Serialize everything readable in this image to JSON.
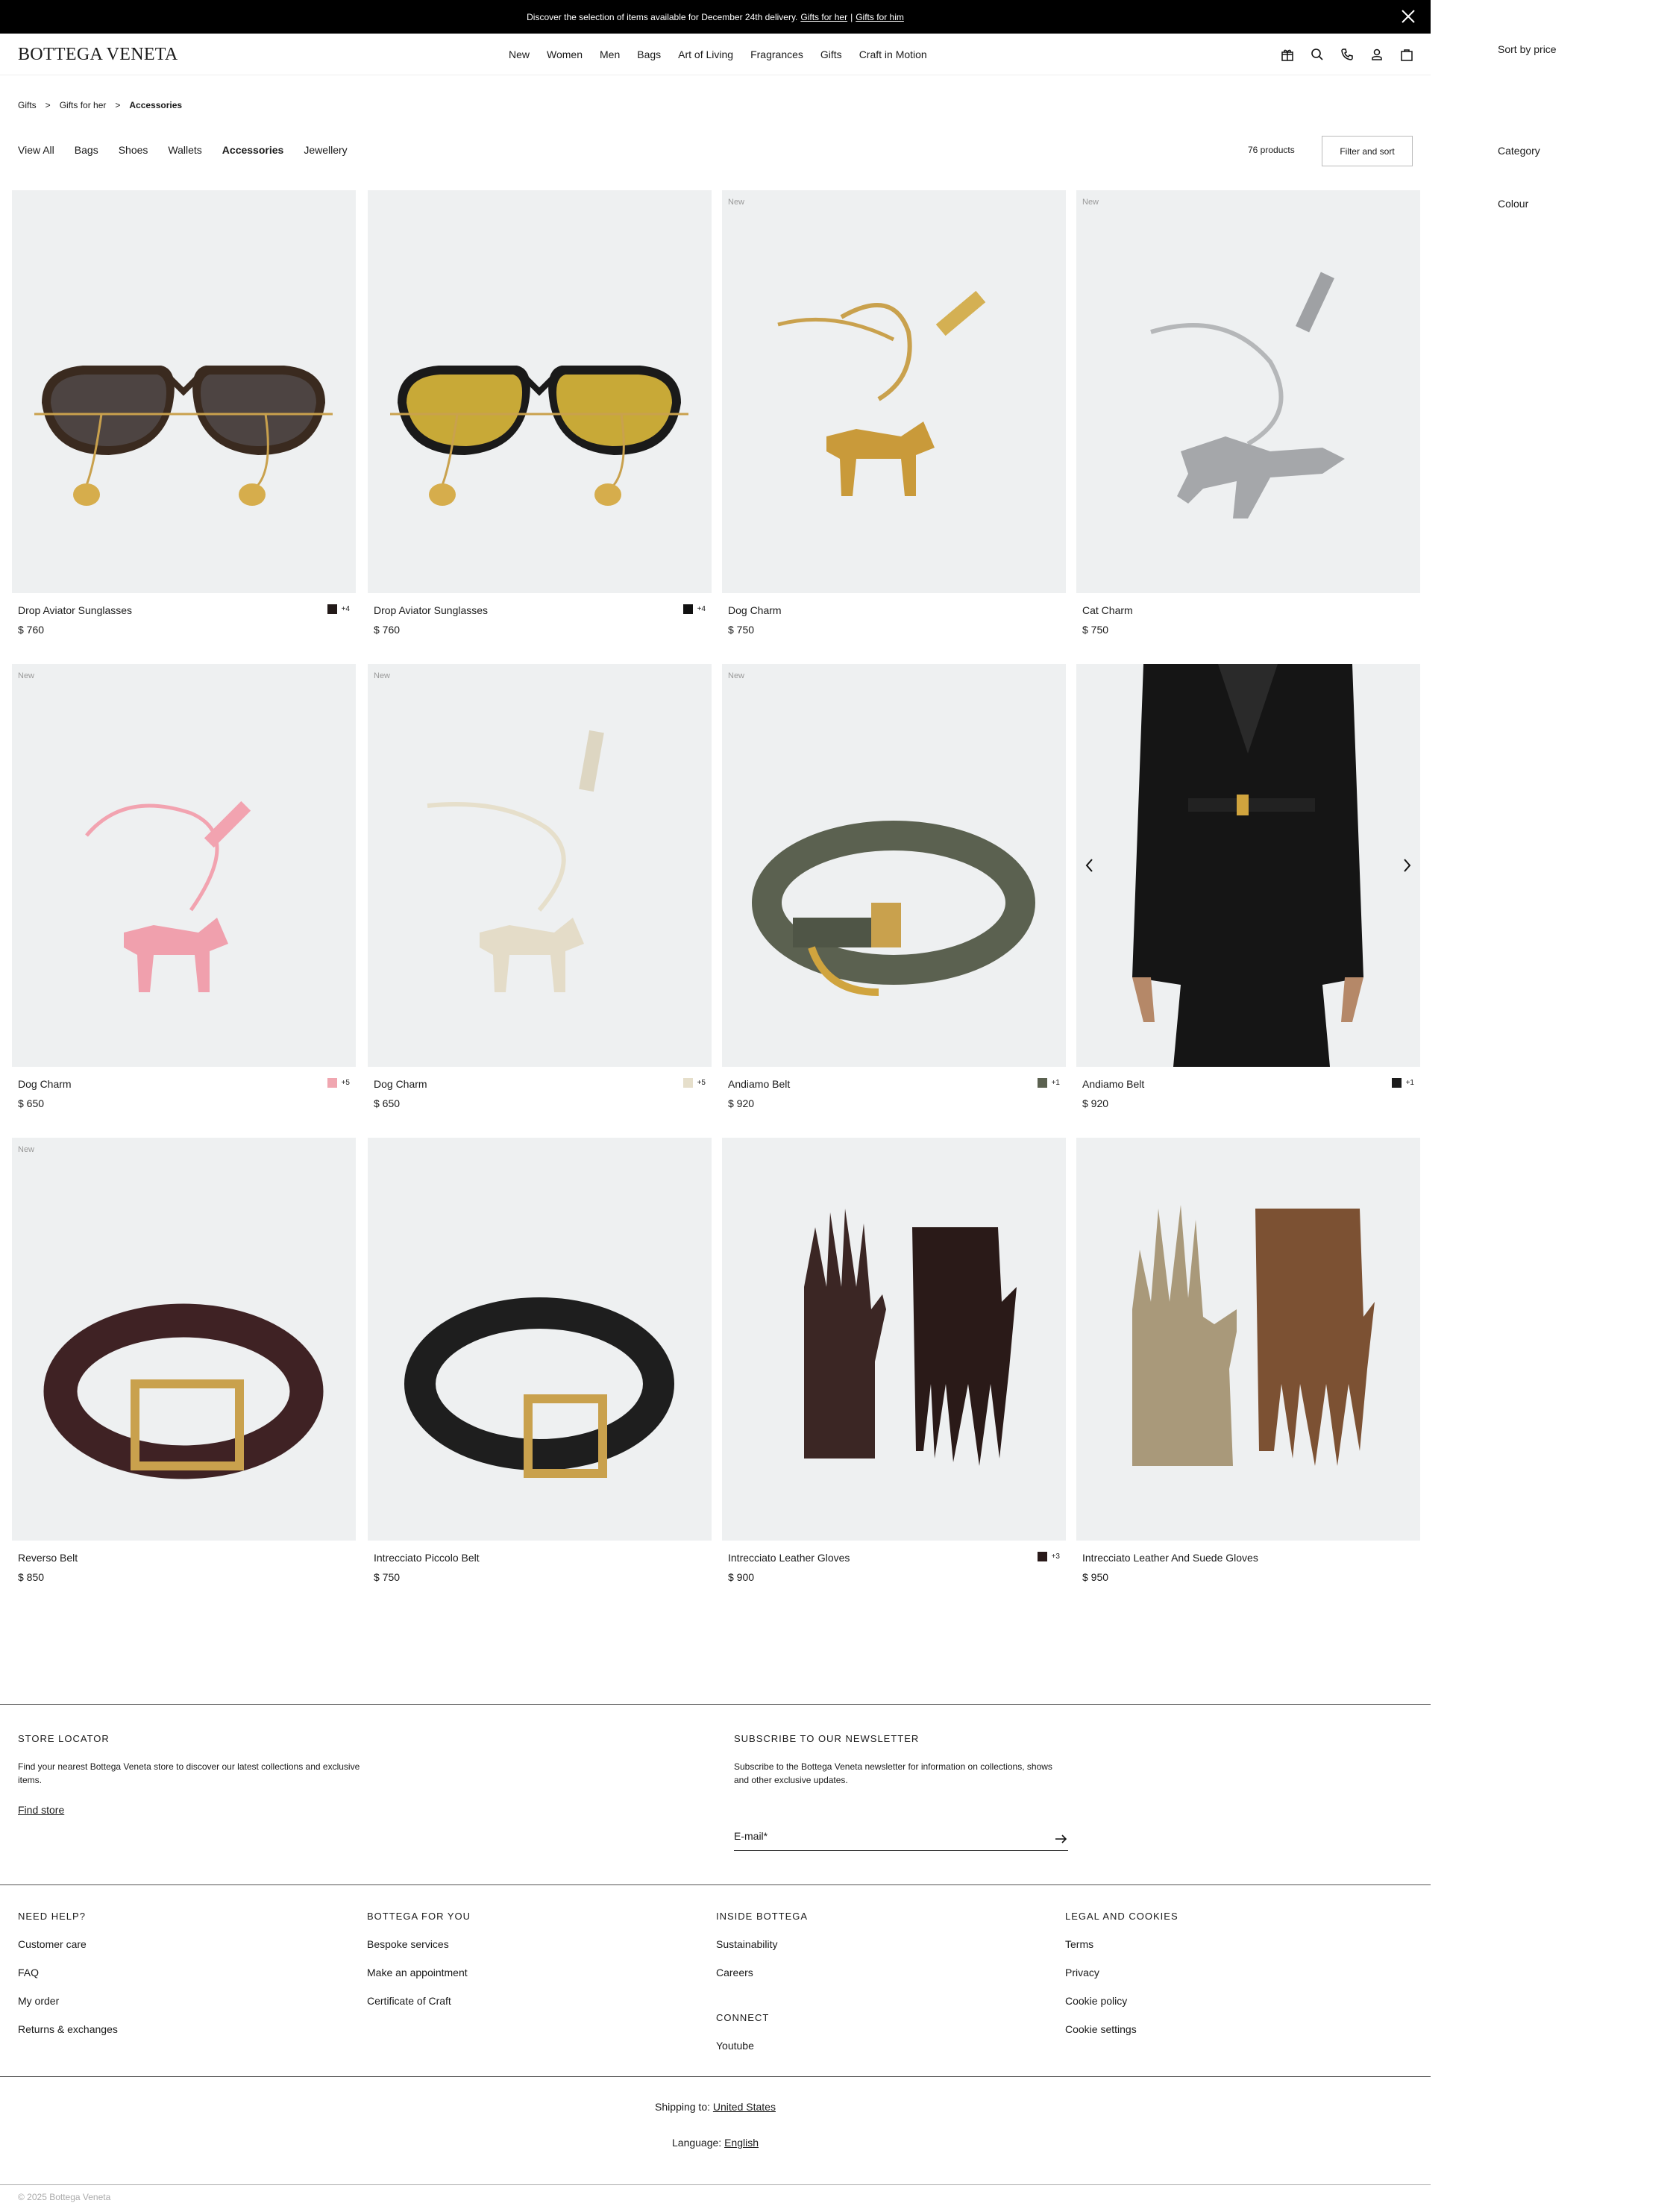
{
  "announcement": {
    "text": "Discover the selection of items available for December 24th delivery.",
    "link1": "Gifts for her",
    "sep": "|",
    "link2": "Gifts for him"
  },
  "header": {
    "logo": "BOTTEGA VENETA",
    "nav": [
      "New",
      "Women",
      "Men",
      "Bags",
      "Art of Living",
      "Fragrances",
      "Gifts",
      "Craft in Motion"
    ],
    "icons": [
      "gift-icon",
      "search-icon",
      "phone-icon",
      "account-icon",
      "bag-icon"
    ]
  },
  "breadcrumb": [
    "Gifts",
    "Gifts for her",
    "Accessories"
  ],
  "categories": [
    "View All",
    "Bags",
    "Shoes",
    "Wallets",
    "Accessories",
    "Jewellery"
  ],
  "active_category": "Accessories",
  "product_count": "76 products",
  "filter_label": "Filter and sort",
  "side_panel": {
    "sort": "Sort by price",
    "category": "Category",
    "colour": "Colour"
  },
  "products": [
    {
      "name": "Drop Aviator Sunglasses",
      "price": "$ 760",
      "badge": "",
      "swatch": "#231a19",
      "more": "+4"
    },
    {
      "name": "Drop Aviator Sunglasses",
      "price": "$ 760",
      "badge": "",
      "swatch": "#111111",
      "more": "+4"
    },
    {
      "name": "Dog Charm",
      "price": "$ 750",
      "badge": "New",
      "swatch": "",
      "more": ""
    },
    {
      "name": "Cat Charm",
      "price": "$ 750",
      "badge": "New",
      "swatch": "",
      "more": ""
    },
    {
      "name": "Dog Charm",
      "price": "$ 650",
      "badge": "New",
      "swatch": "#f0a6b0",
      "more": "+5"
    },
    {
      "name": "Dog Charm",
      "price": "$ 650",
      "badge": "New",
      "swatch": "#e6dfcb",
      "more": "+5"
    },
    {
      "name": "Andiamo Belt",
      "price": "$ 920",
      "badge": "New",
      "swatch": "#5b6150",
      "more": "+1"
    },
    {
      "name": "Andiamo Belt",
      "price": "$ 920",
      "badge": "",
      "swatch": "#1c1c1c",
      "more": "+1"
    },
    {
      "name": "Reverso Belt",
      "price": "$ 850",
      "badge": "New",
      "swatch": "",
      "more": ""
    },
    {
      "name": "Intrecciato Piccolo Belt",
      "price": "$ 750",
      "badge": "",
      "swatch": "",
      "more": ""
    },
    {
      "name": "Intrecciato Leather Gloves",
      "price": "$ 900",
      "badge": "",
      "swatch": "#2a1a1a",
      "more": "+3"
    },
    {
      "name": "Intrecciato Leather And Suede Gloves",
      "price": "$ 950",
      "badge": "",
      "swatch": "",
      "more": ""
    }
  ],
  "footer": {
    "store": {
      "title": "STORE LOCATOR",
      "text": "Find your nearest Bottega Veneta store to discover our latest collections and exclusive items.",
      "link": "Find store"
    },
    "newsletter": {
      "title": "SUBSCRIBE TO OUR NEWSLETTER",
      "text": "Subscribe to the Bottega Veneta newsletter for information on collections, shows and other exclusive updates.",
      "placeholder": "E-mail*"
    },
    "help": {
      "title": "NEED HELP?",
      "links": [
        "Customer care",
        "FAQ",
        "My order",
        "Returns & exchanges"
      ]
    },
    "foryou": {
      "title": "BOTTEGA FOR YOU",
      "links": [
        "Bespoke services",
        "Make an appointment",
        "Certificate of Craft"
      ]
    },
    "inside": {
      "title": "INSIDE BOTTEGA",
      "links": [
        "Sustainability",
        "Careers"
      ]
    },
    "connect": {
      "title": "CONNECT",
      "links": [
        "Youtube"
      ]
    },
    "legal": {
      "title": "LEGAL AND COOKIES",
      "links": [
        "Terms",
        "Privacy",
        "Cookie policy",
        "Cookie settings"
      ]
    },
    "shipping_label": "Shipping to:",
    "shipping_value": "United States",
    "language_label": "Language:",
    "language_value": "English",
    "copyright": "© 2025 Bottega Veneta"
  }
}
